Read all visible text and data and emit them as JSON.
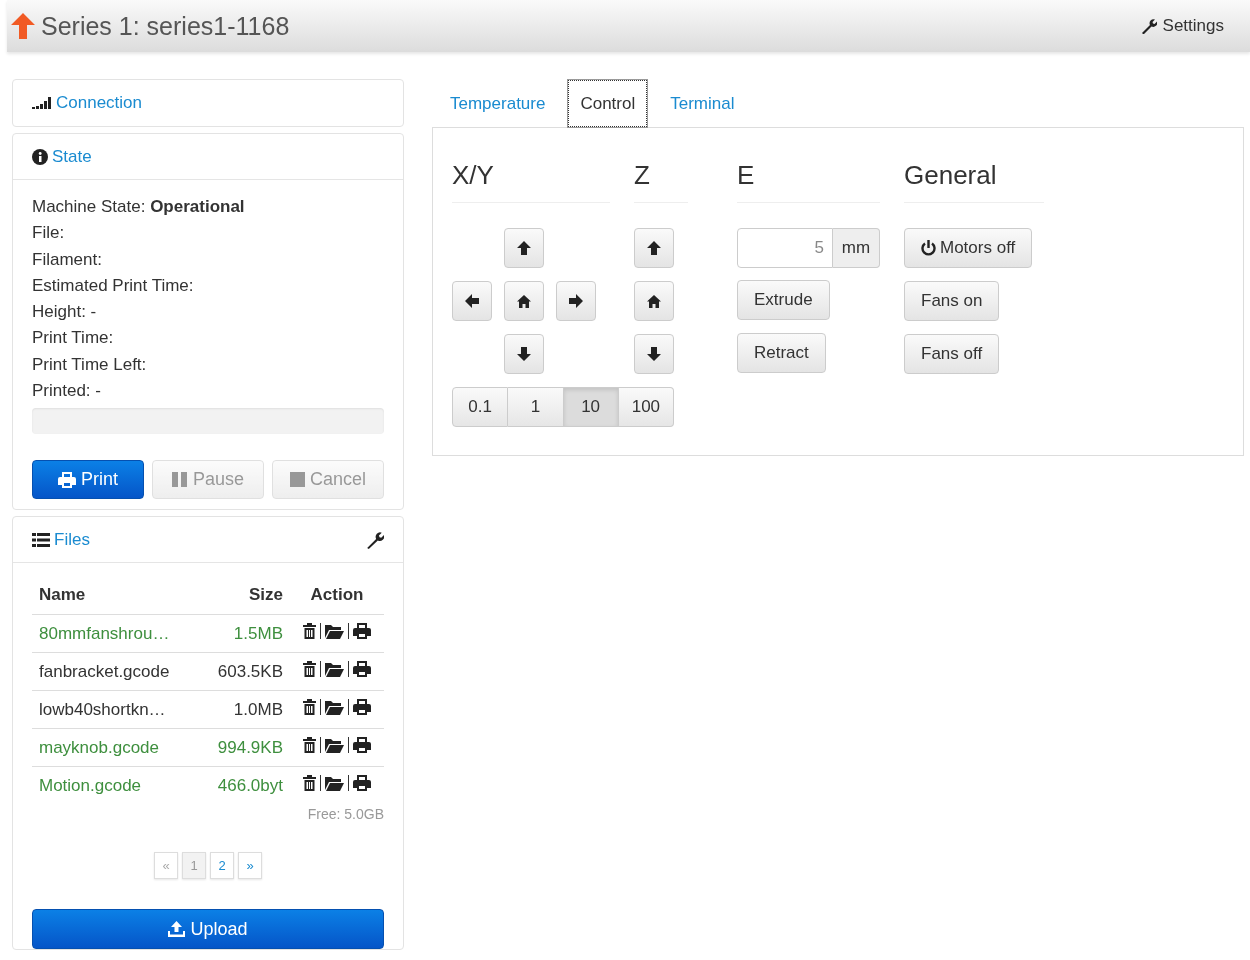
{
  "header": {
    "title": "Series 1: series1-1168",
    "settings": "Settings"
  },
  "sidebar": {
    "connection": {
      "title": "Connection"
    },
    "state": {
      "title": "State",
      "lines": [
        "Machine State: **Operational**",
        "File:",
        "Filament:",
        "Estimated Print Time:",
        "Height: -",
        "Print Time:",
        "Print Time Left:",
        "Printed: -"
      ],
      "progress": {
        "level": 0
      },
      "buttons": [
        {
          "label": "Print",
          "kind": "print",
          "disabled": false
        },
        {
          "label": "Pause",
          "kind": "pause",
          "disabled": true
        },
        {
          "label": "Cancel",
          "kind": "cancel",
          "disabled": true
        }
      ]
    },
    "files": {
      "title": "Files",
      "columns": [
        "Name",
        "Size",
        "Action"
      ],
      "rows": [
        {
          "name": "80mmfanshrou…",
          "size": "1.5MB",
          "color": "#3e8f3e"
        },
        {
          "name": "fanbracket.gcode",
          "size": "603.5KB",
          "color": "#333333"
        },
        {
          "name": "lowb40shortkn…",
          "size": "1.0MB",
          "color": "#333333"
        },
        {
          "name": "mayknob.gcode",
          "size": "994.9KB",
          "color": "#3e8f3e"
        },
        {
          "name": "Motion.gcode",
          "size": "466.0byt",
          "color": "#3e8f3e"
        }
      ],
      "free": "Free: 5.0GB",
      "pagination": [
        {
          "label": "«",
          "selected": false,
          "disabled": true
        },
        {
          "label": "1",
          "selected": true,
          "disabled": false
        },
        {
          "label": "2",
          "selected": false,
          "disabled": false
        },
        {
          "label": "»",
          "selected": false,
          "disabled": false
        }
      ],
      "upload": "Upload"
    }
  },
  "tabs": [
    {
      "label": "Temperature",
      "selected": false
    },
    {
      "label": "Control",
      "selected": true
    },
    {
      "label": "Terminal",
      "selected": false
    }
  ],
  "control": {
    "xy": {
      "title": "X/Y",
      "steps": [
        {
          "label": "0.1",
          "selected": false
        },
        {
          "label": "1",
          "selected": false
        },
        {
          "label": "10",
          "selected": true
        },
        {
          "label": "100",
          "selected": false
        }
      ]
    },
    "z": {
      "title": "Z"
    },
    "e": {
      "title": "E",
      "amount": {
        "value": "5",
        "unit": "mm"
      },
      "buttons": [
        "Extrude",
        "Retract"
      ]
    },
    "general": {
      "title": "General",
      "buttons": [
        {
          "label": "Motors off",
          "kind": "power"
        },
        {
          "label": "Fans on",
          "kind": "plain"
        },
        {
          "label": "Fans off",
          "kind": "plain"
        }
      ]
    }
  }
}
